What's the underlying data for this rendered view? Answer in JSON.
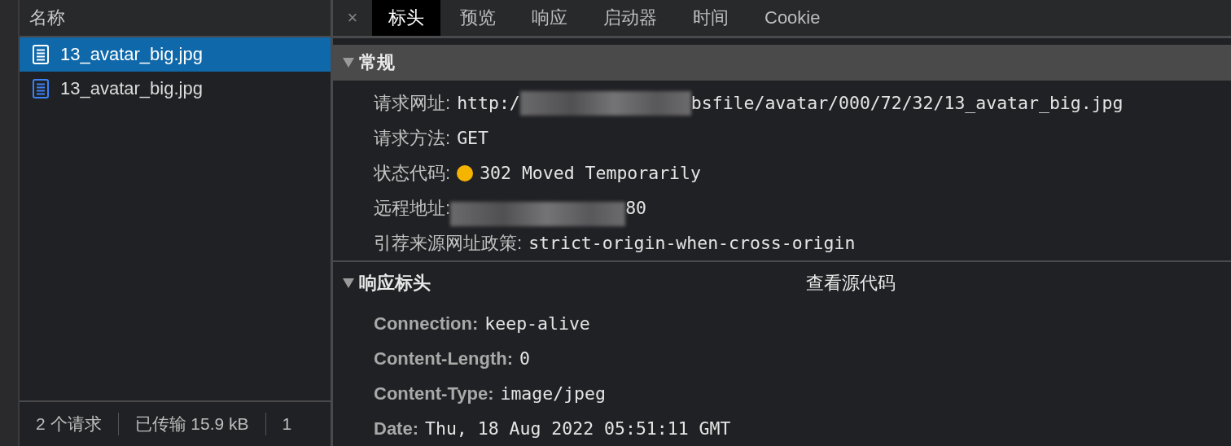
{
  "requests": {
    "column_header": "名称",
    "items": [
      {
        "name": "13_avatar_big.jpg",
        "selected": true
      },
      {
        "name": "13_avatar_big.jpg",
        "selected": false
      }
    ]
  },
  "summary": [
    "2 个请求",
    "已传输 15.9 kB",
    "1"
  ],
  "close": "×",
  "tabs": [
    {
      "label": "标头",
      "selected": true
    },
    {
      "label": "预览",
      "selected": false
    },
    {
      "label": "响应",
      "selected": false
    },
    {
      "label": "启动器",
      "selected": false
    },
    {
      "label": "时间",
      "selected": false
    },
    {
      "label": "Cookie",
      "selected": false
    }
  ],
  "general": {
    "title": "常规",
    "expanded": true,
    "rows": [
      {
        "kind": "redacted",
        "label": "请求网址:",
        "value_start": "http:/",
        "value_end": "bsfile/avatar/000/72/32/13_avatar_big.jpg"
      },
      {
        "kind": "text",
        "label": "请求方法:",
        "value": "GET"
      },
      {
        "kind": "status",
        "label": "状态代码:",
        "value": "302 Moved Temporarily",
        "color": "#f5b400"
      },
      {
        "kind": "redacted",
        "label": "远程地址:",
        "value_end": "80"
      },
      {
        "kind": "text",
        "label": "引荐来源网址政策:",
        "value": "strict-origin-when-cross-origin"
      }
    ]
  },
  "response_headers": {
    "title": "响应标头",
    "expanded": true,
    "view_source": "查看源代码",
    "rows": [
      {
        "label": "Connection:",
        "value": "keep-alive"
      },
      {
        "label": "Content-Length:",
        "value": "0"
      },
      {
        "label": "Content-Type:",
        "value": "image/jpeg"
      },
      {
        "label": "Date:",
        "value": "Thu, 18 Aug 2022 05:51:11 GMT"
      }
    ]
  }
}
